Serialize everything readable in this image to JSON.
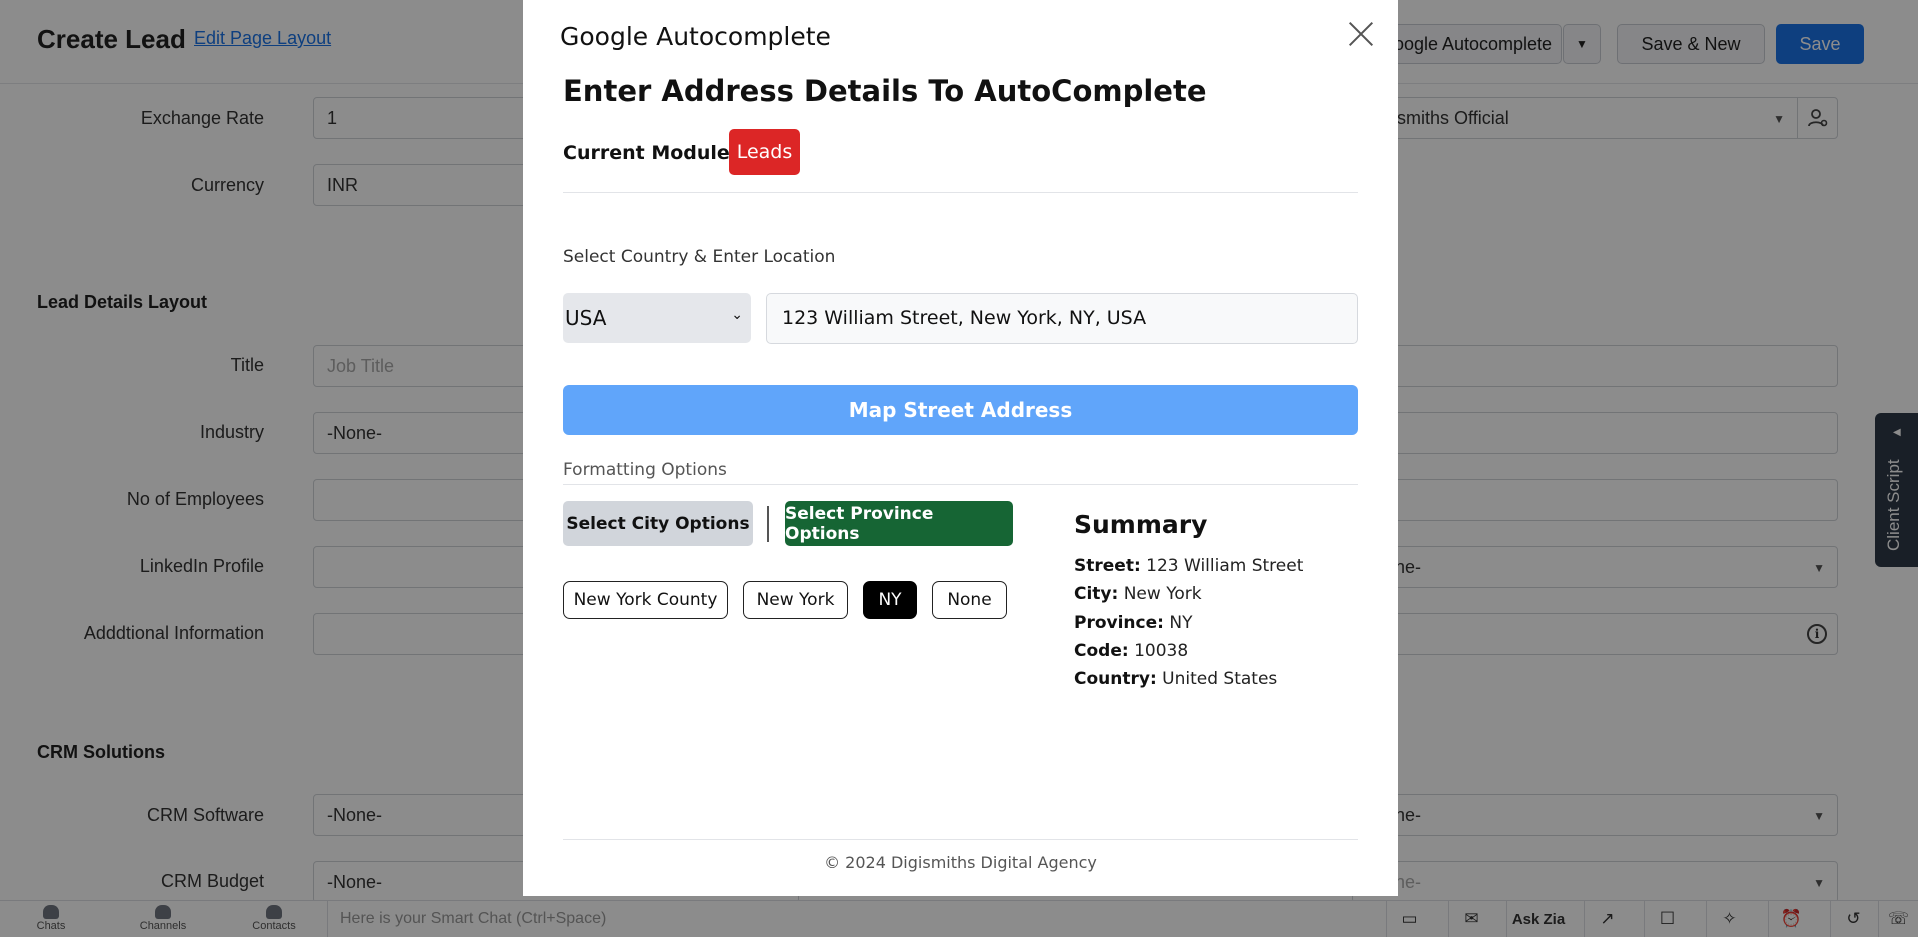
{
  "header": {
    "title": "Create Lead",
    "edit_layout_link": "Edit Page Layout",
    "google_autocomplete_button": "Google Autocomplete",
    "save_and_new": "Save & New",
    "save": "Save"
  },
  "form": {
    "exchange_rate": {
      "label": "Exchange Rate",
      "value": "1"
    },
    "currency": {
      "label": "Currency",
      "value": "INR"
    },
    "lead_owner_value": "Digismiths Official",
    "section_lead_details": "Lead Details Layout",
    "title": {
      "label": "Title",
      "placeholder": "Job Title"
    },
    "industry": {
      "label": "Industry",
      "value": "-None-"
    },
    "no_of_employees": {
      "label": "No of Employees",
      "value": ""
    },
    "linkedin_profile": {
      "label": "LinkedIn Profile",
      "value": ""
    },
    "right_linkedin_row_value": "-None-",
    "additional_information": {
      "label": "Adddtional Information",
      "value": ""
    },
    "section_crm_solutions": "CRM Solutions",
    "crm_software": {
      "label": "CRM Software",
      "value": "-None-"
    },
    "right_crm_software_value": "-None-",
    "crm_budget": {
      "label": "CRM Budget",
      "value": "-None-"
    },
    "right_crm_budget_value": "-None-"
  },
  "client_script": "Client Script",
  "bottom_bar": {
    "chats": "Chats",
    "channels": "Channels",
    "contacts": "Contacts",
    "smart_chat_placeholder": "Here is your Smart Chat (Ctrl+Space)",
    "ask_zia": "Ask Zia"
  },
  "modal": {
    "title": "Google Autocomplete",
    "heading": "Enter Address Details To AutoComplete",
    "current_module_label": "Current Module :",
    "current_module_value": "Leads",
    "select_label": "Select Country & Enter Location",
    "country": "USA",
    "location": "123 William Street, New York, NY, USA",
    "map_button": "Map Street Address",
    "formatting_label": "Formatting Options",
    "city_options_button": "Select City Options",
    "province_options_button": "Select Province Options",
    "options": [
      "New York County",
      "New York",
      "NY",
      "None"
    ],
    "selected_option": "NY",
    "summary": {
      "title": "Summary",
      "street_label": "Street:",
      "street": "123 William Street",
      "city_label": "City:",
      "city": "New York",
      "province_label": "Province:",
      "province": "NY",
      "code_label": "Code:",
      "code": "10038",
      "country_label": "Country:",
      "country": "United States"
    },
    "footer": "© 2024 Digismiths Digital Agency"
  },
  "colors": {
    "leads_badge": "#dc2626",
    "map_button": "#60a5fa",
    "province_button": "#166534",
    "save_button": "#1a73e8"
  }
}
